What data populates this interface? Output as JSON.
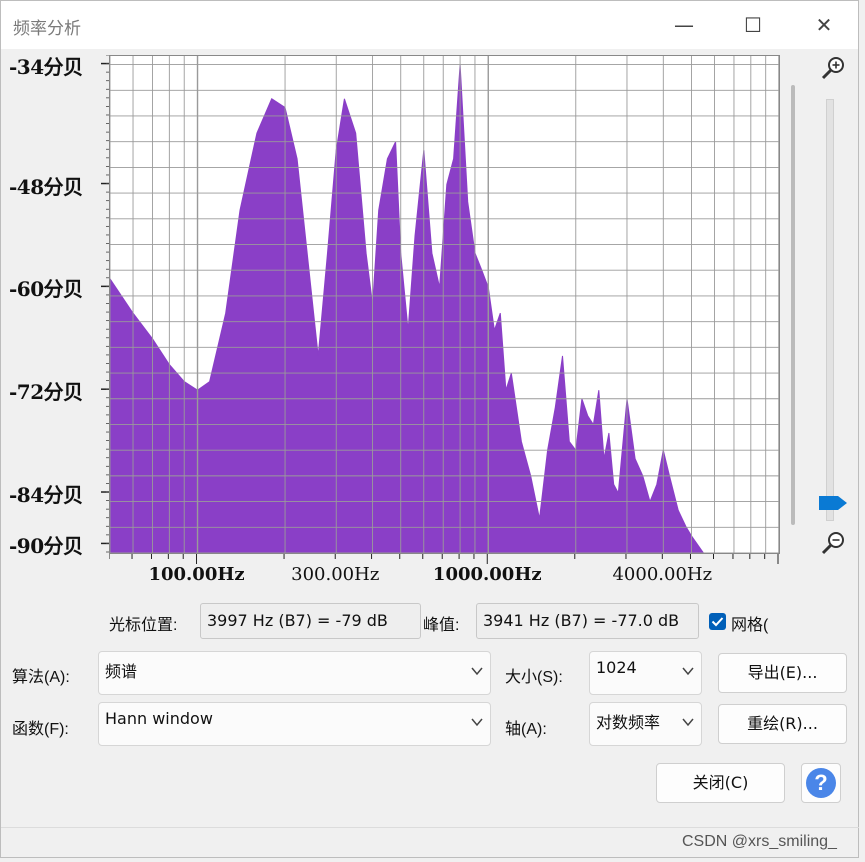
{
  "window": {
    "title": "频率分析",
    "minimize_glyph": "—",
    "maximize_glyph": "☐",
    "close_glyph": "✕"
  },
  "chart_data": {
    "type": "area",
    "x_scale": "log",
    "xlim": [
      50,
      10000
    ],
    "ylim": [
      -91,
      -33
    ],
    "yticks": [
      "-34分贝",
      "-48分贝",
      "-60分贝",
      "-72分贝",
      "-84分贝",
      "-90分贝"
    ],
    "xticks": [
      {
        "label": "100.00Hz",
        "bold": true
      },
      {
        "label": "300.00Hz",
        "bold": false
      },
      {
        "label": "1000.00Hz",
        "bold": true
      },
      {
        "label": "4000.00Hz",
        "bold": false
      }
    ],
    "fill_color": "#8a3fc7",
    "grid": true,
    "series": [
      {
        "x": [
          50,
          60,
          70,
          80,
          90,
          100,
          110,
          125,
          140,
          160,
          180,
          200,
          220,
          240,
          260,
          280,
          300,
          320,
          350,
          380,
          400,
          420,
          450,
          480,
          500,
          530,
          560,
          600,
          640,
          680,
          720,
          760,
          800,
          850,
          900,
          950,
          1000,
          1050,
          1100,
          1150,
          1200,
          1300,
          1400,
          1500,
          1600,
          1700,
          1800,
          1900,
          2000,
          2100,
          2200,
          2300,
          2400,
          2500,
          2600,
          2700,
          2800,
          3000,
          3200,
          3400,
          3600,
          3800,
          4000,
          4200,
          4500,
          4800,
          5000,
          5500,
          6000,
          6500,
          7000
        ],
        "y": [
          -59,
          -63,
          -66,
          -69,
          -71,
          -72,
          -71,
          -63,
          -51,
          -42,
          -38,
          -39,
          -45,
          -57,
          -68,
          -56,
          -44,
          -38,
          -42,
          -56,
          -62,
          -51,
          -45,
          -43,
          -56,
          -65,
          -54,
          -44,
          -56,
          -60,
          -48,
          -45,
          -34,
          -50,
          -56,
          -58,
          -60,
          -65,
          -63,
          -72,
          -70,
          -78,
          -82,
          -87,
          -79,
          -74,
          -68,
          -78,
          -79,
          -73,
          -75,
          -76,
          -72,
          -80,
          -77,
          -83,
          -84,
          -73,
          -80,
          -82,
          -85,
          -83,
          -79,
          -82,
          -86,
          -88,
          -89,
          -91,
          -91,
          -91,
          -91
        ]
      }
    ]
  },
  "controls": {
    "cursor_label": "光标位置:",
    "cursor_value": "3997 Hz (B7) = -79 dB",
    "peak_label": "峰值:",
    "peak_value": "3941 Hz (B7) = -77.0 dB",
    "grid_checkbox_label": "网格(",
    "grid_checked": true,
    "algorithm_label": "算法(A):",
    "algorithm_value": "频谱",
    "size_label": "大小(S):",
    "size_value": "1024",
    "function_label": "函数(F):",
    "function_value": "Hann window",
    "axis_label": "轴(A):",
    "axis_value": "对数频率",
    "export_button": "导出(E)...",
    "replot_button": "重绘(R)...",
    "close_button": "关闭(C)",
    "help_glyph": "?"
  },
  "watermark": "CSDN @xrs_smiling_",
  "colors": {
    "accent": "#005fb8",
    "spectrum": "#8a3fc7",
    "help": "#4a86e8"
  }
}
